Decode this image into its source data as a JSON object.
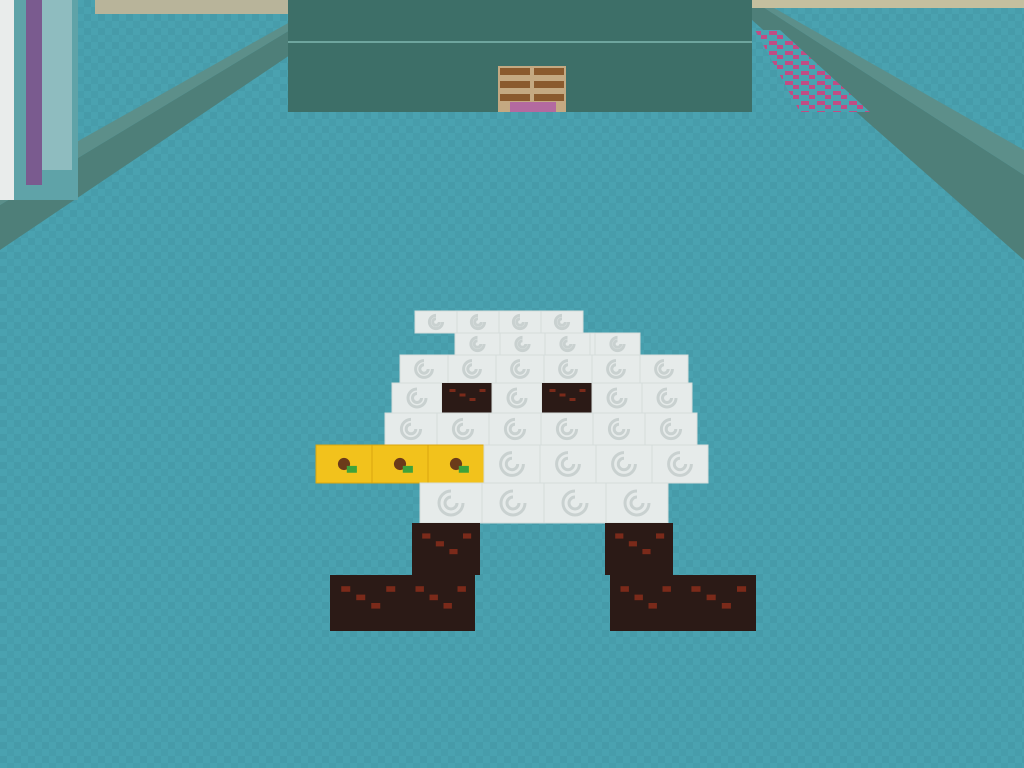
{
  "scene": {
    "kind": "voxel-game-first-person-view",
    "sprite": "duck-pixel-art",
    "colors": {
      "sky": "#8fd1dc",
      "floor": "#4aa2b0",
      "floor_dark": "#3e8e9b",
      "wall_top": "#5c8f8a",
      "wall_face": "#4e7f79",
      "far_wall": "#3d6f68",
      "far_wall_bottom": "#315c57",
      "door_wood": "#8a5a2e",
      "pink_tiles": "#c04d84",
      "left_column_white": "#e9eceb",
      "left_column_purple": "#7a5b8f",
      "left_column_teal": "#5fa3a8",
      "duck_white": "#e6ebea",
      "duck_swirl": "#c9d1d0",
      "dark_block": "#2b1a16",
      "dark_block_speck": "#7a2a1a",
      "beak_yellow": "#f2c21c",
      "beak_seed": "#6b3b1a",
      "beak_leaf": "#3fa23a"
    }
  }
}
